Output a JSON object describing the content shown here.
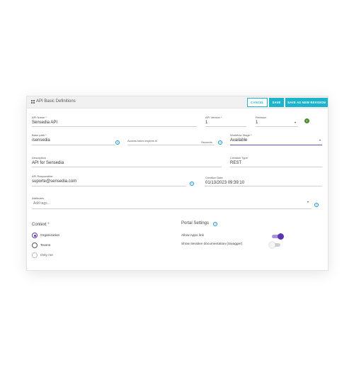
{
  "header": {
    "title": "API Basic Definitions",
    "cancel_label": "CANCEL",
    "save_label": "SAVE",
    "save_new_revision_label": "SAVE AS NEW REVISION"
  },
  "fields": {
    "api_name": {
      "label": "API Name *",
      "value": "Sensedia API"
    },
    "api_version": {
      "label": "API Version *",
      "value": "1"
    },
    "revision": {
      "label": "Revision",
      "value": "1"
    },
    "base_path": {
      "label": "Base path *",
      "value": "/sensedia"
    },
    "access_token": {
      "label": "Access token expires in",
      "unit": "Seconds"
    },
    "workflow_stage": {
      "label": "Workflow Stage *",
      "value": "Available"
    },
    "description": {
      "label": "Description",
      "value": "API for Sensedia"
    },
    "creation_type": {
      "label": "Creation Type",
      "value": "REST"
    },
    "api_responsible": {
      "label": "API Responsible",
      "value": "suporte@sensedia.com"
    },
    "creation_date": {
      "label": "Creation Date",
      "value": "01/13/2023 09:39:10"
    },
    "attributes": {
      "label": "Attributes",
      "placeholder": "Add tags..."
    }
  },
  "context": {
    "title": "Context",
    "required_mark": "*",
    "options": [
      {
        "label": "Organization",
        "selected": true
      },
      {
        "label": "Teams",
        "selected": false
      },
      {
        "label": "Only me",
        "selected": false,
        "disabled": true
      }
    ]
  },
  "portal": {
    "title": "Portal Settings",
    "settings": [
      {
        "label": "Allow Apps link",
        "on": true
      },
      {
        "label": "Show iterative documentation (Swagger)",
        "on": false
      }
    ]
  },
  "colors": {
    "accent_teal": "#1bb4cb",
    "accent_purple": "#5e35b1",
    "status_green": "#4e8d2f",
    "info_blue": "#1f8fd3"
  },
  "icons": {
    "info": "i",
    "status": "!"
  }
}
